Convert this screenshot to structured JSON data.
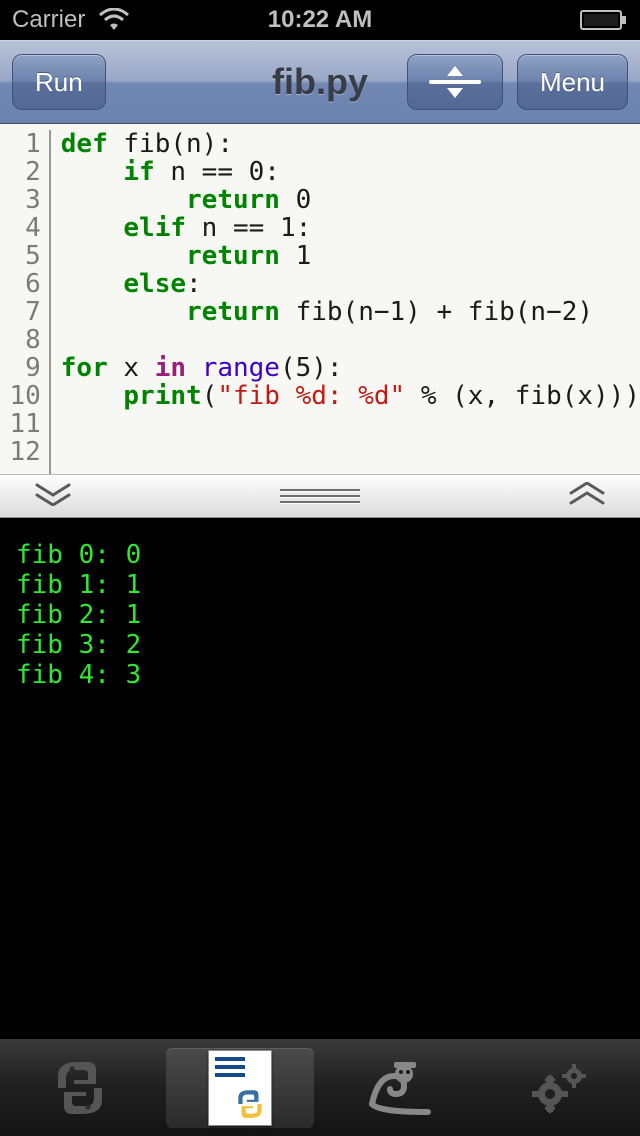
{
  "status_bar": {
    "carrier": "Carrier",
    "time": "10:22 AM"
  },
  "navbar": {
    "run_label": "Run",
    "title": "fib.py",
    "menu_label": "Menu"
  },
  "editor": {
    "line_count": 12,
    "code_lines": [
      [
        {
          "t": "def ",
          "c": "kw"
        },
        {
          "t": "fib(n):",
          "c": ""
        }
      ],
      [
        {
          "t": "    ",
          "c": ""
        },
        {
          "t": "if",
          "c": "kw"
        },
        {
          "t": " n == ",
          "c": ""
        },
        {
          "t": "0",
          "c": "num"
        },
        {
          "t": ":",
          "c": ""
        }
      ],
      [
        {
          "t": "        ",
          "c": ""
        },
        {
          "t": "return",
          "c": "kw"
        },
        {
          "t": " ",
          "c": ""
        },
        {
          "t": "0",
          "c": "num"
        }
      ],
      [
        {
          "t": "    ",
          "c": ""
        },
        {
          "t": "elif",
          "c": "kw"
        },
        {
          "t": " n == ",
          "c": ""
        },
        {
          "t": "1",
          "c": "num"
        },
        {
          "t": ":",
          "c": ""
        }
      ],
      [
        {
          "t": "        ",
          "c": ""
        },
        {
          "t": "return",
          "c": "kw"
        },
        {
          "t": " ",
          "c": ""
        },
        {
          "t": "1",
          "c": "num"
        }
      ],
      [
        {
          "t": "    ",
          "c": ""
        },
        {
          "t": "else",
          "c": "kw"
        },
        {
          "t": ":",
          "c": ""
        }
      ],
      [
        {
          "t": "        ",
          "c": ""
        },
        {
          "t": "return",
          "c": "kw"
        },
        {
          "t": " fib(n",
          "c": ""
        },
        {
          "t": "−",
          "c": "op"
        },
        {
          "t": "1",
          "c": "num"
        },
        {
          "t": ") + fib(n",
          "c": ""
        },
        {
          "t": "−",
          "c": "op"
        },
        {
          "t": "2",
          "c": "num"
        },
        {
          "t": ")",
          "c": ""
        }
      ],
      [],
      [
        {
          "t": "for",
          "c": "kw"
        },
        {
          "t": " x ",
          "c": ""
        },
        {
          "t": "in",
          "c": "kw2"
        },
        {
          "t": " ",
          "c": ""
        },
        {
          "t": "range",
          "c": "fn"
        },
        {
          "t": "(",
          "c": ""
        },
        {
          "t": "5",
          "c": "num"
        },
        {
          "t": "):",
          "c": ""
        }
      ],
      [
        {
          "t": "    ",
          "c": ""
        },
        {
          "t": "print",
          "c": "kw"
        },
        {
          "t": "(",
          "c": ""
        },
        {
          "t": "\"fib %d: %d\"",
          "c": "str"
        },
        {
          "t": " % (x, fib(x)))",
          "c": ""
        }
      ],
      [],
      []
    ]
  },
  "console": {
    "lines": [
      "fib 0: 0",
      "fib 1: 1",
      "fib 2: 1",
      "fib 3: 2",
      "fib 4: 3"
    ]
  },
  "tabbar": {
    "items": [
      "python",
      "document",
      "snake",
      "settings"
    ],
    "active_index": 1
  }
}
